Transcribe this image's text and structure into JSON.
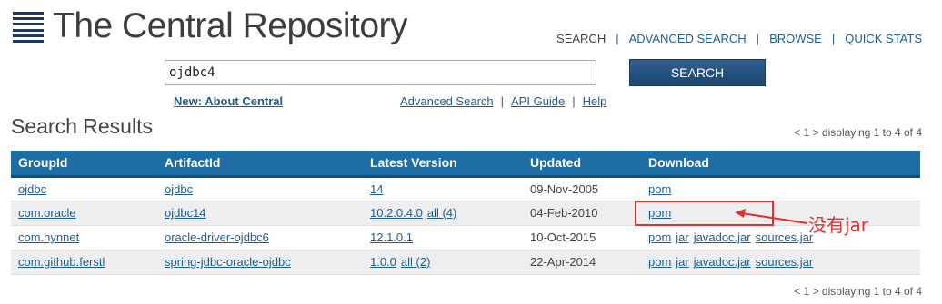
{
  "header": {
    "title": "The Central Repository",
    "nav": [
      {
        "label": "SEARCH",
        "plain": true
      },
      {
        "label": "ADVANCED SEARCH",
        "plain": false
      },
      {
        "label": "BROWSE",
        "plain": false
      },
      {
        "label": "QUICK STATS",
        "plain": false
      }
    ],
    "nav_separator": "|"
  },
  "search": {
    "value": "ojdbc4",
    "button_label": "SEARCH"
  },
  "links": {
    "about": "New: About Central",
    "advanced_search": "Advanced Search",
    "api_guide": "API Guide",
    "help": "Help",
    "separator": "|"
  },
  "results": {
    "title": "Search Results",
    "pager_top": "< 1 > displaying 1 to 4 of 4",
    "pager_bottom": "< 1 > displaying 1 to 4 of 4",
    "columns": [
      "GroupId",
      "ArtifactId",
      "Latest Version",
      "Updated",
      "Download"
    ],
    "rows": [
      {
        "group": "ojdbc",
        "artifact": "ojdbc",
        "version": "14",
        "all": "",
        "updated": "09-Nov-2005",
        "downloads": [
          "pom"
        ]
      },
      {
        "group": "com.oracle",
        "artifact": "ojdbc14",
        "version": "10.2.0.4.0",
        "all": "all (4)",
        "updated": "04-Feb-2010",
        "downloads": [
          "pom"
        ]
      },
      {
        "group": "com.hynnet",
        "artifact": "oracle-driver-ojdbc6",
        "version": "12.1.0.1",
        "all": "",
        "updated": "10-Oct-2015",
        "downloads": [
          "pom",
          "jar",
          "javadoc.jar",
          "sources.jar"
        ]
      },
      {
        "group": "com.github.ferstl",
        "artifact": "spring-jdbc-oracle-ojdbc",
        "version": "1.0.0",
        "all": "all (2)",
        "updated": "22-Apr-2014",
        "downloads": [
          "pom",
          "jar",
          "javadoc.jar",
          "sources.jar"
        ]
      }
    ]
  },
  "annotation": {
    "text": "没有jar",
    "color": "#e03030"
  },
  "colors": {
    "header_bar": "#1e6ea5",
    "link": "#1f5d8f",
    "button": "#1e4670"
  }
}
